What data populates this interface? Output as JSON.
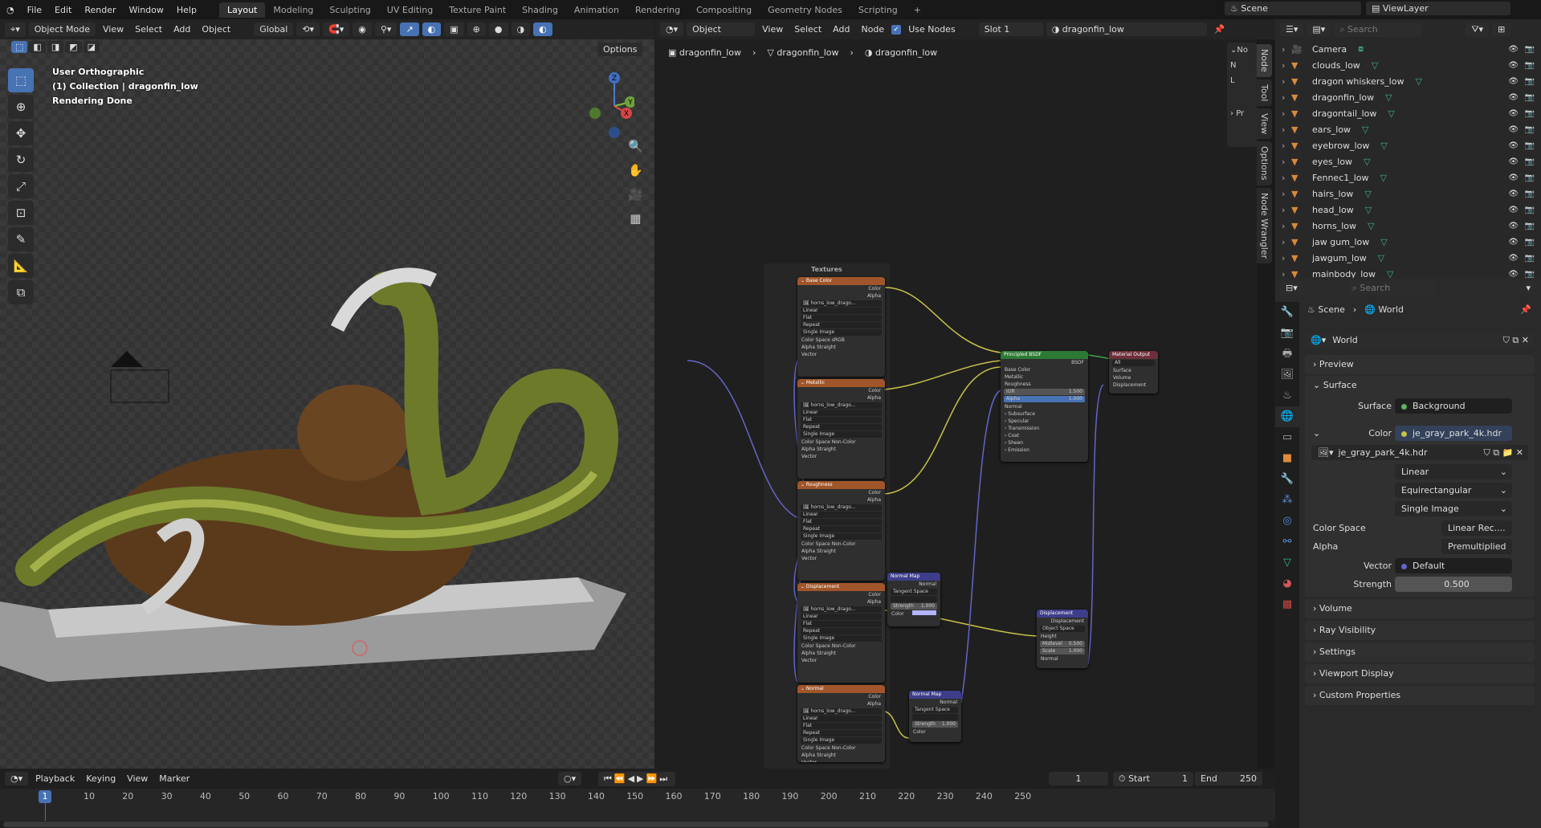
{
  "menu": {
    "items": [
      "File",
      "Edit",
      "Render",
      "Window",
      "Help"
    ]
  },
  "workspaces": [
    "Layout",
    "Modeling",
    "Sculpting",
    "UV Editing",
    "Texture Paint",
    "Shading",
    "Animation",
    "Rendering",
    "Compositing",
    "Geometry Nodes",
    "Scripting"
  ],
  "scene": {
    "name": "Scene",
    "view_layer": "ViewLayer"
  },
  "viewport": {
    "mode": "Object Mode",
    "menus": [
      "View",
      "Select",
      "Add",
      "Object"
    ],
    "orientation": "Global",
    "options": "Options",
    "info": [
      "User Orthographic",
      "(1) Collection | dragonfin_low",
      "Rendering Done"
    ],
    "gizmo": {
      "x": "X",
      "y": "Y",
      "z": "Z"
    }
  },
  "node_editor": {
    "type": "Object",
    "menus": [
      "View",
      "Select",
      "Add",
      "Node"
    ],
    "use_nodes": "Use Nodes",
    "slot": "Slot 1",
    "material": "dragonfin_low",
    "breadcrumb": [
      "dragonfin_low",
      "dragonfin_low",
      "dragonfin_low"
    ],
    "frame_label": "Textures",
    "sidebar": {
      "panel": "No",
      "n": "N",
      "l": "L",
      "pr": "Pr",
      "tabs": [
        "Node",
        "Tool",
        "View",
        "Options",
        "Node Wrangler"
      ]
    },
    "tex_nodes": [
      {
        "title": "Base Color",
        "image": "horns_low_drago...",
        "cs": "sRGB"
      },
      {
        "title": "Metallic",
        "image": "horns_low_drago...",
        "cs": "Non-Color"
      },
      {
        "title": "Roughness",
        "image": "horns_low_drago...",
        "cs": "Non-Color"
      },
      {
        "title": "Displacement",
        "image": "horns_low_drago...",
        "cs": "Non-Color"
      },
      {
        "title": "Normal",
        "image": "horns_low_drago...",
        "cs": "Non-Color"
      }
    ],
    "tex_labels": {
      "color": "Color",
      "alpha": "Alpha",
      "interp": "Linear",
      "proj": "Flat",
      "ext": "Repeat",
      "src": "Single Image",
      "cs_label": "Color Space",
      "alpha_mode": "Straight",
      "vector": "Vector"
    },
    "bsdf": {
      "title": "Principled BSDF",
      "out": "BSDF",
      "inputs": [
        "Base Color",
        "Metallic",
        "Roughness"
      ],
      "ior_label": "IOR",
      "ior": "1.500",
      "alpha_label": "Alpha",
      "alpha": "1.000",
      "normal": "Normal",
      "panels": [
        "Subsurface",
        "Specular",
        "Transmission",
        "Coat",
        "Sheen",
        "Emission"
      ]
    },
    "output": {
      "title": "Material Output",
      "target": "All",
      "inputs": [
        "Surface",
        "Volume",
        "Displacement"
      ]
    },
    "normal_map": {
      "title": "Normal Map",
      "out": "Normal",
      "space": "Tangent Space",
      "strength_label": "Strength",
      "strength": "1.000",
      "color": "Color"
    },
    "displacement": {
      "title": "Displacement",
      "out": "Displacement",
      "space": "Object Space",
      "height": "Height",
      "midlevel_label": "Midlevel",
      "midlevel": "0.500",
      "scale_label": "Scale",
      "scale": "1.000",
      "normal": "Normal"
    }
  },
  "outliner": {
    "search_placeholder": "Search",
    "items": [
      "Camera",
      "clouds_low",
      "dragon whiskers_low",
      "dragonfin_low",
      "dragontail_low",
      "ears_low",
      "eyebrow_low",
      "eyes_low",
      "Fennec1_low",
      "hairs_low",
      "head_low",
      "horns_low",
      "jaw gum_low",
      "jawgum_low",
      "mainbody_low"
    ]
  },
  "properties": {
    "search_placeholder": "Search",
    "breadcrumb": [
      "Scene",
      "World"
    ],
    "world": "World",
    "sections": {
      "preview": "Preview",
      "surface": "Surface",
      "volume": "Volume",
      "ray": "Ray Visibility",
      "settings": "Settings",
      "viewport": "Viewport Display",
      "custom": "Custom Properties"
    },
    "surface_label": "Surface",
    "surface_value": "Background",
    "color_label": "Color",
    "color_value": "je_gray_park_4k.hdr",
    "image": "je_gray_park_4k.hdr",
    "interp": "Linear",
    "proj": "Equirectangular",
    "source": "Single Image",
    "cs_label": "Color Space",
    "cs": "Linear Rec....",
    "alpha_label": "Alpha",
    "alpha": "Premultiplied",
    "vector_label": "Vector",
    "vector": "Default",
    "strength_label": "Strength",
    "strength": "0.500"
  },
  "timeline": {
    "menus": [
      "Playback",
      "Keying",
      "View",
      "Marker"
    ],
    "current": "1",
    "start_label": "Start",
    "start": "1",
    "end_label": "End",
    "end": "250",
    "ticks": [
      "10",
      "20",
      "30",
      "40",
      "50",
      "60",
      "70",
      "80",
      "90",
      "100",
      "110",
      "120",
      "130",
      "140",
      "150",
      "160",
      "170",
      "180",
      "190",
      "200",
      "210",
      "220",
      "230",
      "240",
      "250"
    ]
  },
  "colors": {
    "accent": "#4772b3",
    "tex_header": "#a0562a",
    "bsdf_header": "#2d7a34",
    "output_header": "#6e2f3a",
    "vector_header": "#3d3d8a",
    "yellow_link": "#c7c04a",
    "blue_link": "#6464c8"
  }
}
